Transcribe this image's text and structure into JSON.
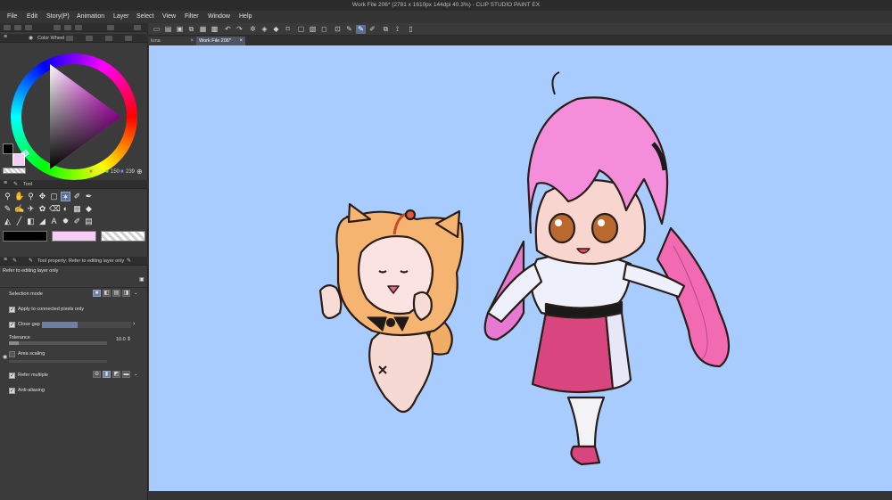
{
  "window": {
    "title": "Work File 206* (2781 x 1610px 144dpi 40.3%)  - CLIP STUDIO PAINT EX"
  },
  "menu": [
    "File",
    "Edit",
    "Story(P)",
    "Animation",
    "Layer",
    "Select",
    "View",
    "Filter",
    "Window",
    "Help"
  ],
  "doc_tabs": {
    "tab1": "tuna",
    "tab2": "Work File 206*",
    "close": "×"
  },
  "color_wheel": {
    "title": "Color Wheel",
    "r": "238",
    "g": "150",
    "b": "239",
    "main_color": "#000000",
    "sub_color": "#f7cdf7"
  },
  "tool_panel": {
    "title": "Tool"
  },
  "tool_property": {
    "title": "Tool property: Refer to editing layer only",
    "subtitle": "Refer to editing layer only",
    "selection_mode": "Selection mode",
    "apply_connected": "Apply to connected pixels only",
    "close_gap": "Close gap",
    "tolerance": "Tolerance",
    "tolerance_value": "10.0",
    "area_scaling": "Area scaling",
    "refer_multiple": "Refer multiple",
    "anti_aliasing": "Anti-aliasing"
  },
  "colors": {
    "canvas_bg": "#a9ccfe",
    "accent": "#5c6f96",
    "panel_bg": "#3b3b3b"
  }
}
